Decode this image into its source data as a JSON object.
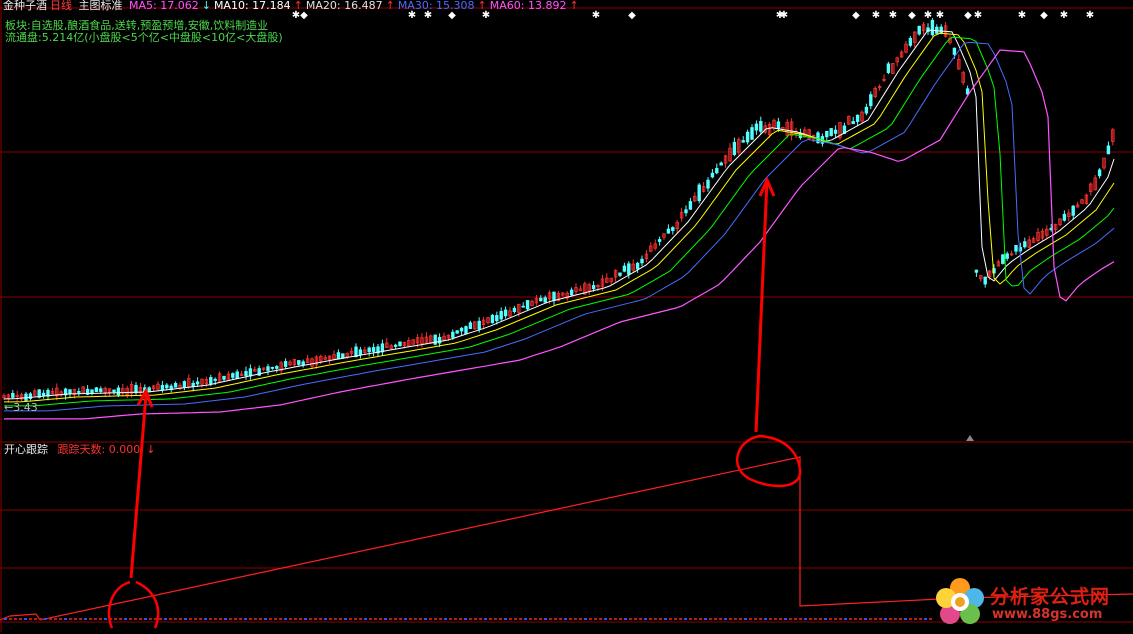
{
  "header": {
    "stock_name": "金种子酒",
    "period": "日线",
    "chart_mode": "主图标准",
    "ma": [
      {
        "label": "MA5: 17.062",
        "arrow": "↓",
        "color": "#ff55ff"
      },
      {
        "label": "MA10: 17.184",
        "arrow": "↑",
        "color": "#ffffff"
      },
      {
        "label": "MA20: 16.487",
        "arrow": "↑",
        "color": "#e0e0e0"
      },
      {
        "label": "MA30: 15.308",
        "arrow": "↑",
        "color": "#4a6cff"
      },
      {
        "label": "MA60: 13.892",
        "arrow": "↑",
        "color": "#ff55ff"
      }
    ]
  },
  "info": {
    "sector": "板块:自选股,酿酒食品,送转,预盈预增,安徽,饮料制造业",
    "float": "流通盘:5.214亿(小盘股<5个亿<中盘股<10亿<大盘股)"
  },
  "low_marker": "3.43",
  "indicator": {
    "name": "开心跟踪",
    "label": "跟踪天数: 0.000",
    "arrow": "↓"
  },
  "watermark": {
    "text": "分析家公式网",
    "url": "www.88gs.com"
  },
  "colors": {
    "up": "#ff3030",
    "down": "#54ffff",
    "grid": "#8a0000",
    "ma5": "#ffffff",
    "ma10": "#ffff00",
    "ma20": "#00ff00",
    "ma30": "#4a6cff",
    "ma60": "#ff55ff",
    "annotation": "#ff0000"
  }
}
